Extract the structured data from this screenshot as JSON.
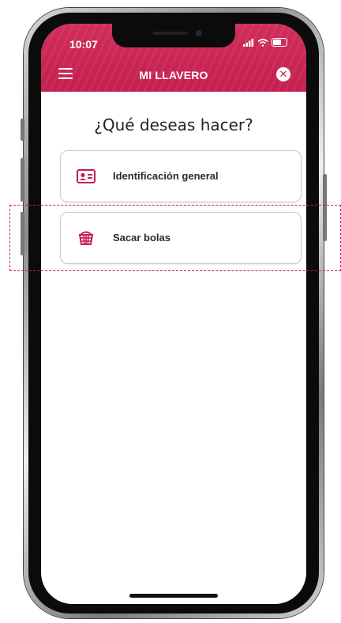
{
  "status_bar": {
    "time": "10:07"
  },
  "header": {
    "title": "MI LLAVERO"
  },
  "main": {
    "question": "¿Qué deseas hacer?",
    "options": [
      {
        "label": "Identificación general",
        "icon": "id-card-icon"
      },
      {
        "label": "Sacar bolas",
        "icon": "ball-basket-icon"
      }
    ]
  },
  "colors": {
    "brand": "#c4204f",
    "text": "#2a2a2a",
    "border": "#c9c9c9"
  }
}
